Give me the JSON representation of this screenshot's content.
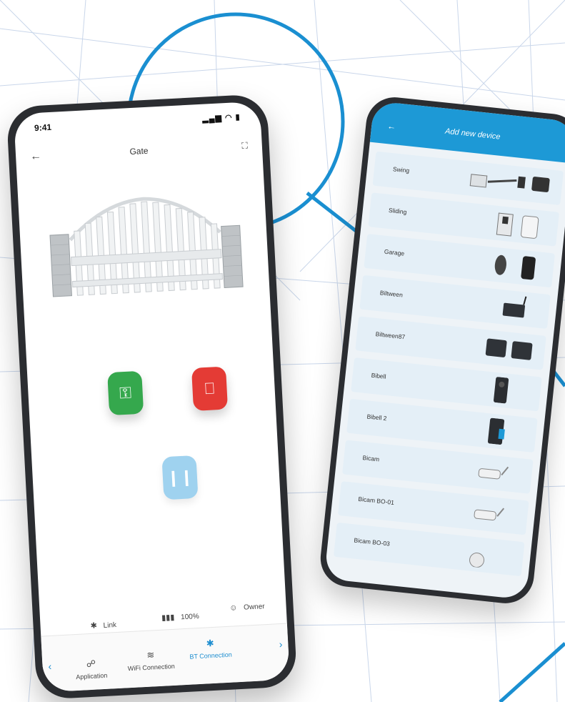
{
  "left_phone": {
    "status": {
      "time": "9:41",
      "icons": "▂▄▆ ◠ ▮"
    },
    "nav": {
      "back_icon": "←",
      "title": "Gate",
      "expand_icon": "⛶"
    },
    "buttons": {
      "open_icon": "⚿",
      "close_icon": "⎕",
      "pause_icon": "❙❙",
      "open_color": "#35a84d",
      "close_color": "#e43b35",
      "pause_color": "#9fd2ef"
    },
    "info": {
      "link_icon": "✱",
      "link_label": "Link",
      "battery_icon": "▮▮▮",
      "battery_label": "100%",
      "owner_icon": "☺",
      "owner_label": "Owner"
    },
    "tabs": [
      {
        "icon": "☍",
        "label": "Application"
      },
      {
        "icon": "≋",
        "label": "WiFi Connection"
      },
      {
        "icon": "✱",
        "label": "BT Connection"
      }
    ],
    "tab_chevron_left": "‹",
    "tab_chevron_right": "›",
    "accent_color": "#1e8ed0"
  },
  "right_phone": {
    "header": {
      "back_icon": "←",
      "title": "Add new device",
      "color": "#1d99d6"
    },
    "devices": [
      {
        "label": "Swing"
      },
      {
        "label": "Sliding"
      },
      {
        "label": "Garage"
      },
      {
        "label": "Biltween"
      },
      {
        "label": "Biltween87"
      },
      {
        "label": "Bibell"
      },
      {
        "label": "Bibell 2"
      },
      {
        "label": "Bicam"
      },
      {
        "label": "Bicam BO-01"
      },
      {
        "label": "Bicam BO-03"
      }
    ]
  }
}
